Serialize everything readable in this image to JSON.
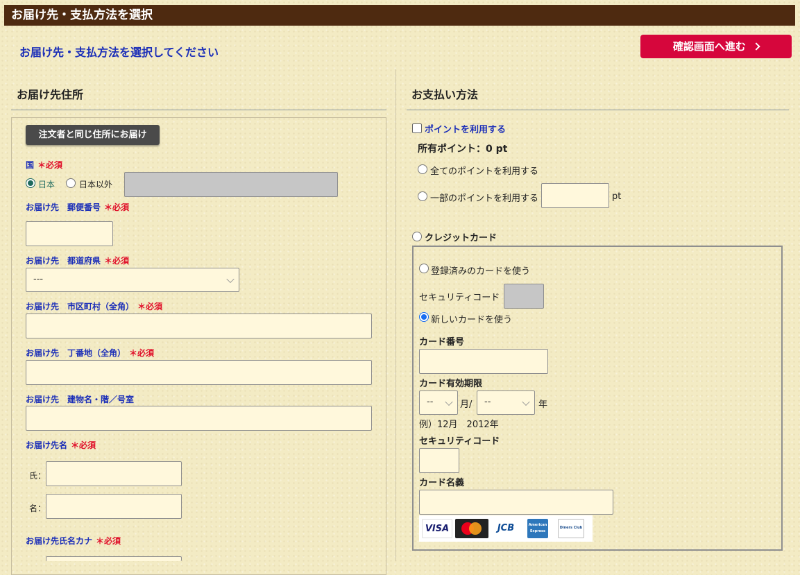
{
  "header": {
    "title": "お届け先・支払方法を選択",
    "subtitle": "お届け先・支払方法を選択してください",
    "confirm_button": "確認画面へ進む"
  },
  "shipping": {
    "section_title": "お届け先住所",
    "same_address_button": "注文者と同じ住所にお届け",
    "required_mark": "＊必須",
    "country": {
      "label": "国",
      "option_japan": "日本",
      "option_other": "日本以外",
      "selected": "日本"
    },
    "postal_label": "お届け先　郵便番号",
    "prefecture_label": "お届け先　都道府県",
    "prefecture_value": "---",
    "city_label": "お届け先　市区町村（全角）",
    "street_label": "お届け先　丁番地（全角）",
    "building_label": "お届け先　建物名・階／号室",
    "name_label": "お届け先名",
    "last_name_label": "氏：",
    "first_name_label": "名：",
    "kana_label": "お届け先氏名カナ"
  },
  "payment": {
    "section_title": "お支払い方法",
    "use_points_label": "ポイントを利用する",
    "points_owned": "所有ポイント：0 pt",
    "use_all_points": "全てのポイントを利用する",
    "use_some_points": "一部のポイントを利用する",
    "points_unit": "pt",
    "credit_card_label": "クレジットカード",
    "use_saved_card": "登録済みのカードを使う",
    "saved_security_code_label": "セキュリティコード",
    "use_new_card": "新しいカードを使う",
    "card_number_label": "カード番号",
    "expiry_label": "カード有効期限",
    "month_value": "--",
    "month_unit": "月/",
    "year_value": "--",
    "year_unit": "年",
    "expiry_example": "例）12月　2012年",
    "security_code_label": "セキュリティコード",
    "card_holder_label": "カード名義",
    "card_brands": [
      "VISA",
      "Mastercard",
      "JCB",
      "American Express",
      "Diners Club"
    ],
    "colors": {
      "accent": "#d6063c",
      "header": "#4e2a10",
      "label": "#1c2fb8",
      "required": "#e0102a"
    }
  }
}
